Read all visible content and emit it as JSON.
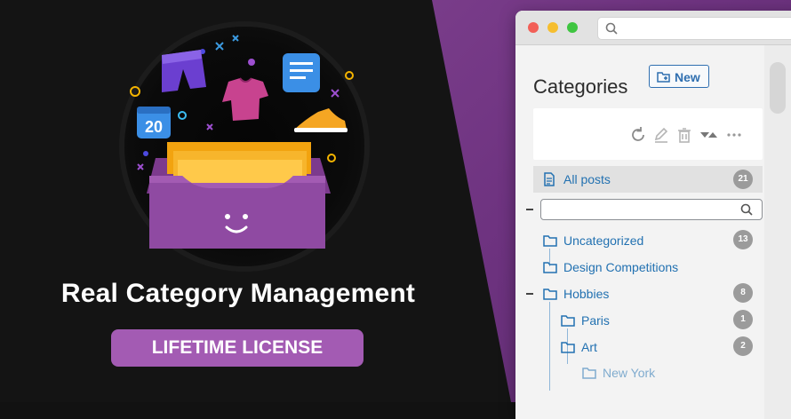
{
  "promo": {
    "title": "Real Category Management",
    "badge": "LIFETIME LICENSE",
    "calendar_number": "20"
  },
  "window": {
    "heading": "Categories",
    "new_button": "New",
    "all_posts": {
      "label": "All posts",
      "count": "21"
    },
    "search_placeholder": "",
    "categories": [
      {
        "label": "Uncategorized",
        "count": "13"
      },
      {
        "label": "Design Competitions",
        "count": ""
      },
      {
        "label": "Hobbies",
        "count": "8"
      },
      {
        "label": "Paris",
        "count": "1"
      },
      {
        "label": "Art",
        "count": "2"
      },
      {
        "label": "New York",
        "count": ""
      }
    ]
  },
  "colors": {
    "accent_purple": "#a35bb3",
    "link_blue": "#2271b1",
    "count_gray": "#9b9b9b"
  }
}
